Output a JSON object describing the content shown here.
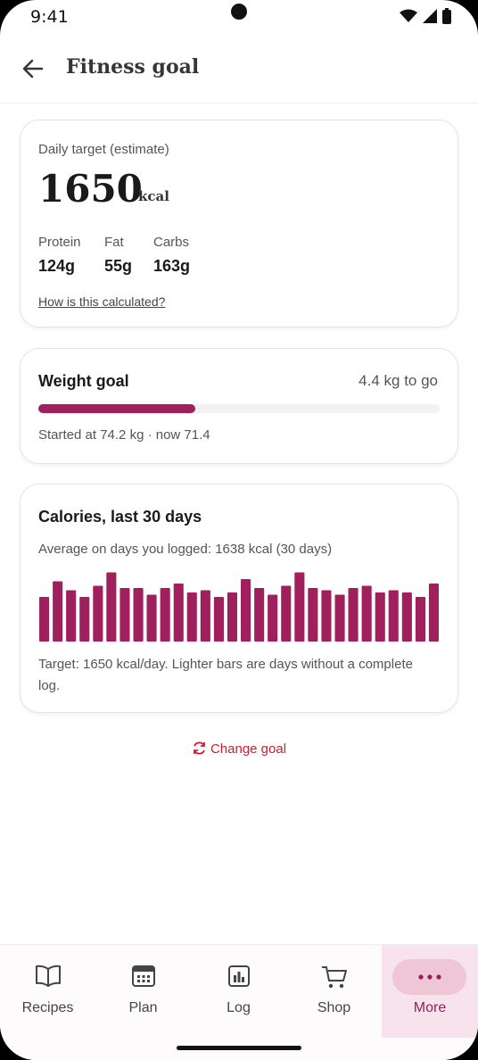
{
  "status_bar": {
    "time": "9:41"
  },
  "header": {
    "title": "Fitness goal"
  },
  "daily_target": {
    "label": "Daily target (estimate)",
    "value": "1650",
    "unit": "kcal",
    "macros": [
      {
        "label": "Protein",
        "value": "124g"
      },
      {
        "label": "Fat",
        "value": "55g"
      },
      {
        "label": "Carbs",
        "value": "163g"
      }
    ],
    "link": "How is this calculated?"
  },
  "weight_goal": {
    "title": "Weight goal",
    "to_go": "4.4 kg to go",
    "progress_fraction": 0.39,
    "subtitle": "Started at 74.2 kg · now 71.4"
  },
  "calories": {
    "title": "Calories, last 30 days",
    "average": "Average on days you logged: 1638 kcal (30 days)",
    "note": "Target: 1650 kcal/day. Lighter bars are days without a complete log.",
    "bar_color": "#a0205e",
    "daily_kcal": [
      1600,
      1670,
      1630,
      1600,
      1650,
      1710,
      1640,
      1640,
      1610,
      1640,
      1660,
      1620,
      1630,
      1600,
      1620,
      1680,
      1640,
      1610,
      1650,
      1710,
      1640,
      1630,
      1610,
      1640,
      1650,
      1620,
      1630,
      1620,
      1600,
      1660
    ]
  },
  "change_goal": "Change goal",
  "nav": {
    "items": [
      {
        "label": "Recipes",
        "icon": "book-icon"
      },
      {
        "label": "Plan",
        "icon": "calendar-icon"
      },
      {
        "label": "Log",
        "icon": "chart-icon"
      },
      {
        "label": "Shop",
        "icon": "cart-icon"
      },
      {
        "label": "More",
        "icon": "more-dots-icon",
        "active": true
      }
    ]
  },
  "colors": {
    "accent": "#a0205e",
    "link_red": "#d7192f"
  }
}
